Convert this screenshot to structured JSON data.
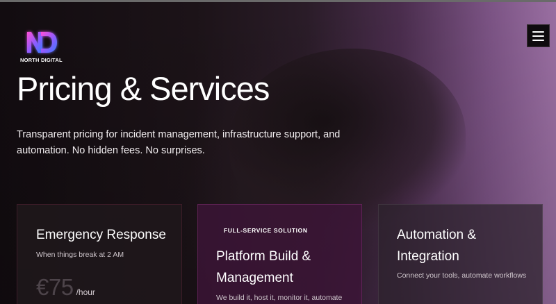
{
  "brand": {
    "name": "NORTH DIGITAL",
    "logo_letters": "ND"
  },
  "nav": {
    "menu_icon": "hamburger-menu-icon"
  },
  "hero": {
    "title": "Pricing & Services",
    "subtitle": "Transparent pricing for incident management, infrastructure support, and automation. No hidden fees. No surprises."
  },
  "cards": [
    {
      "title": "Emergency Response",
      "description": "When things break at 2 AM",
      "price": "€75",
      "price_unit": "/hour"
    },
    {
      "badge": "FULL-SERVICE SOLUTION",
      "title": "Platform Build & Management",
      "description": "We build it, host it, monitor it, automate"
    },
    {
      "title": "Automation & Integration",
      "description": "Connect your tools, automate workflows"
    }
  ],
  "colors": {
    "accent_pink": "#e040c8",
    "accent_blue": "#3a7bff",
    "background_purple": "#9a6fa2"
  }
}
